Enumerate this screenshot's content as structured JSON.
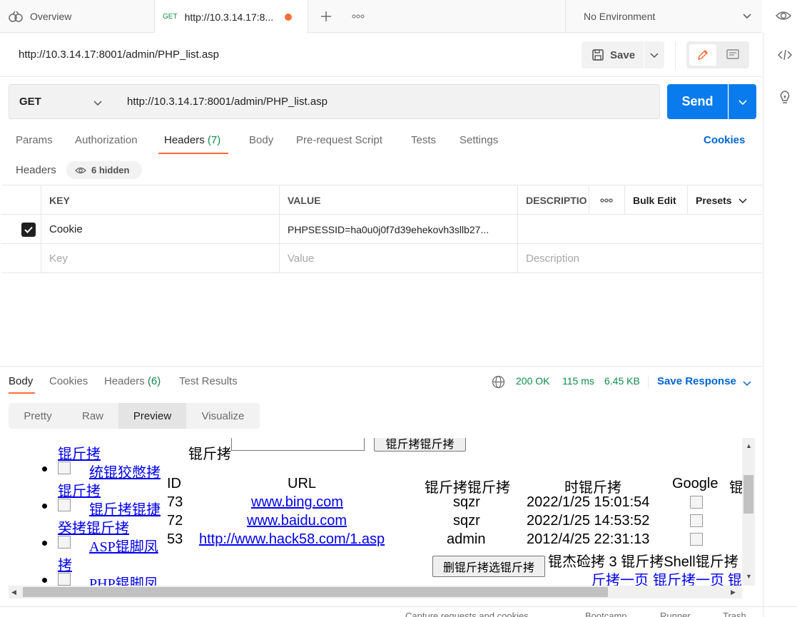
{
  "tabbar": {
    "overview_label": "Overview",
    "request_tab": {
      "method": "GET",
      "url": "http://10.3.14.17:8..."
    },
    "environment": "No Environment"
  },
  "request": {
    "name": "http://10.3.14.17:8001/admin/PHP_list.asp",
    "save_label": "Save",
    "method": "GET",
    "url": "http://10.3.14.17:8001/admin/PHP_list.asp",
    "send_label": "Send"
  },
  "request_tabs": {
    "params": "Params",
    "authorization": "Authorization",
    "headers_label": "Headers",
    "headers_count": "(7)",
    "body": "Body",
    "prerequest": "Pre-request Script",
    "tests": "Tests",
    "settings": "Settings",
    "cookies": "Cookies"
  },
  "headers_section": {
    "title": "Headers",
    "hidden_badge": "6 hidden",
    "columns": {
      "key": "KEY",
      "value": "VALUE",
      "description": "DESCRIPTIO",
      "bulk_edit": "Bulk Edit",
      "presets": "Presets"
    },
    "rows": [
      {
        "key": "Cookie",
        "value": "PHPSESSID=ha0u0j0f7d39ehekovh3sllb27...",
        "checked": true
      }
    ],
    "placeholder": {
      "key": "Key",
      "value": "Value",
      "description": "Description"
    }
  },
  "response": {
    "tabs": {
      "body": "Body",
      "cookies": "Cookies",
      "headers_label": "Headers",
      "headers_count": "(6)",
      "test_results": "Test Results"
    },
    "status": "200 OK",
    "time": "115 ms",
    "size": "6.45 KB",
    "save_response": "Save Response",
    "views": [
      "Pretty",
      "Raw",
      "Preview",
      "Visualize"
    ],
    "active_view": "Preview"
  },
  "preview": {
    "sidebar_links": [
      "锟斤拷",
      "统锟狡憋拷",
      "锟斤拷",
      "锟斤拷锟捷",
      "癸拷锟斤拷",
      "ASP锟脚凤",
      "拷",
      "PHP锟脚凤"
    ],
    "search_label": "锟斤拷",
    "search_button": "锟斤拷锟斤拷",
    "table_headers": [
      "ID",
      "URL",
      "锟斤拷锟斤拷",
      "时锟斤拷",
      "Google",
      "锟"
    ],
    "table_rows": [
      {
        "id": "73",
        "url": "www.bing.com",
        "user": "sqzr",
        "time": "2022/1/25 15:01:54"
      },
      {
        "id": "72",
        "url": "www.baidu.com",
        "user": "sqzr",
        "time": "2022/1/25 14:53:52"
      },
      {
        "id": "53",
        "url": "http://www.hack58.com/1.asp",
        "user": "admin",
        "time": "2012/4/25 22:31:13"
      }
    ],
    "delete_button": "删锟斤拷选锟斤拷",
    "summary_text": "锟杰硷拷 3 锟斤拷Shell锟斤拷",
    "pager_prev": "斤拷一页",
    "pager_next": "锟斤拷一页",
    "pager_tail": "锟"
  },
  "statusbar": {
    "capture": "Capture requests and cookies",
    "bootcamp": "Bootcamp",
    "runner": "Runner",
    "trash": "Trash"
  },
  "colors": {
    "accent": "#ff6c37",
    "send": "#097bed",
    "success": "#0f8a4b",
    "link": "#0265d2"
  }
}
